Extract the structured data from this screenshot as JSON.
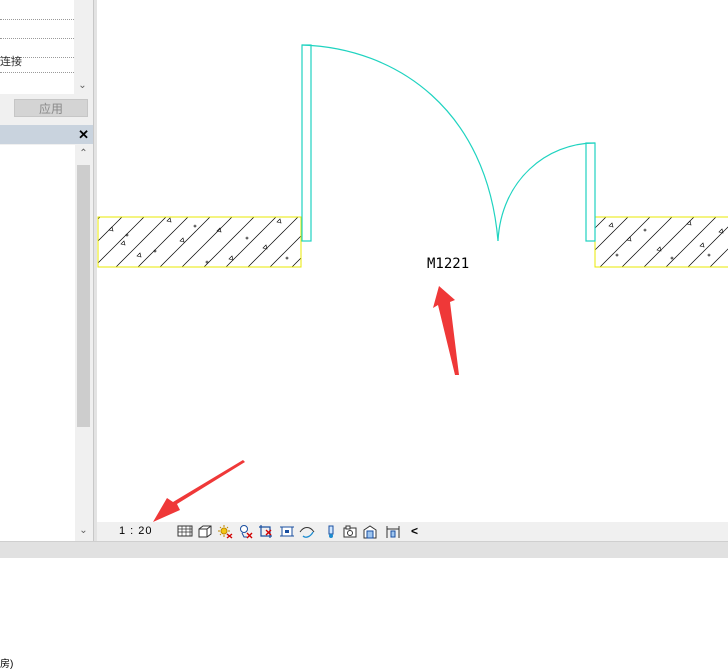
{
  "properties": {
    "rows": [
      "",
      "",
      "",
      "连接",
      ""
    ],
    "apply_label": "应用"
  },
  "project_browser": {
    "close_glyph": "✕",
    "tail_text": "房)"
  },
  "canvas": {
    "door_tag": "M1221",
    "colors": {
      "wall_outline": "#e8e800",
      "door": "#1fd3c0",
      "arrow": "#ef3838"
    }
  },
  "view_control_bar": {
    "scale": "1 : 20",
    "icons": [
      "detail-level-icon",
      "visual-style-icon",
      "sun-path-icon",
      "shadows-icon",
      "crop-view-icon",
      "show-crop-region-icon",
      "temporary-hide-icon",
      "reveal-hidden-icon",
      "analytical-model-icon",
      "highlight-displacement-icon",
      "constraints-icon"
    ],
    "more_glyph": "<"
  }
}
